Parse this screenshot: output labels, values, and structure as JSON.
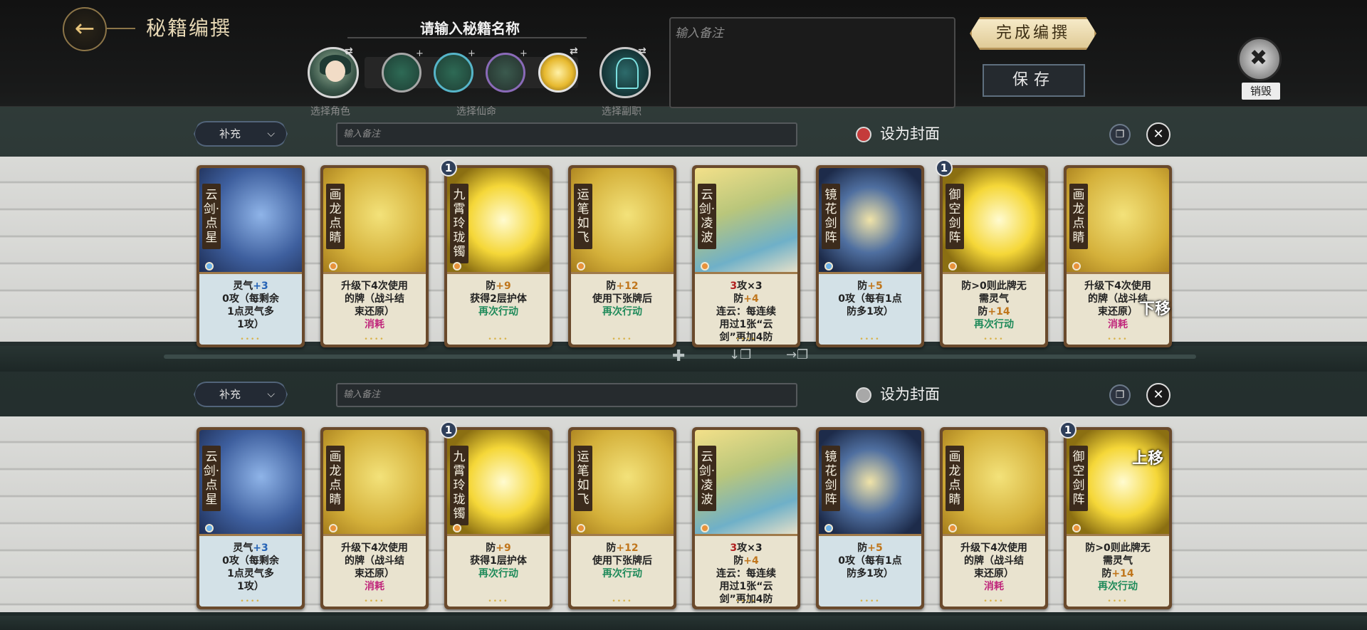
{
  "header": {
    "title": "秘籍编撰",
    "name_label": "请输入秘籍名称",
    "captions": {
      "character": "选择角色",
      "destiny": "选择仙命",
      "side_job": "选择副职"
    },
    "note_placeholder": "输入备注",
    "finish_label": "完成编撰",
    "save_label": "保存",
    "destroy_label": "销毁"
  },
  "rows": [
    {
      "supply_label": "补充",
      "note_placeholder": "输入备注",
      "cover_label": "设为封面",
      "cover_active": true,
      "move_hint": "下移",
      "cards": [
        {
          "name": "云剑·点星",
          "level": "",
          "desc": [
            "灵气+3",
            "0攻（每剩余",
            "1点灵气多",
            "1攻）"
          ]
        },
        {
          "name": "画龙点睛",
          "level": "",
          "desc": [
            "升级下4次使用",
            "的牌（战斗结",
            "束还原）",
            "消耗"
          ]
        },
        {
          "name": "九霄玲珑镯",
          "level": "1",
          "desc": [
            "防+9",
            "获得2层护体",
            "再次行动"
          ]
        },
        {
          "name": "运笔如飞",
          "level": "",
          "desc": [
            "防+12",
            "使用下张牌后",
            "再次行动"
          ]
        },
        {
          "name": "云剑·凌波",
          "level": "",
          "desc": [
            "3攻×3",
            "防+4",
            "连云：每连续",
            "用过1张“云",
            "剑”再加4防"
          ]
        },
        {
          "name": "镜花剑阵",
          "level": "",
          "desc": [
            "防+5",
            "0攻（每有1点",
            "防多1攻）"
          ]
        },
        {
          "name": "御空剑阵",
          "level": "1",
          "desc": [
            "防>0则此牌无",
            "需灵气",
            "防+14",
            "再次行动"
          ]
        },
        {
          "name": "画龙点睛",
          "level": "",
          "desc": [
            "升级下4次使用",
            "的牌（战斗结",
            "束还原）",
            "消耗"
          ]
        }
      ]
    },
    {
      "supply_label": "补充",
      "note_placeholder": "输入备注",
      "cover_label": "设为封面",
      "cover_active": false,
      "move_hint": "上移",
      "cards": [
        {
          "name": "云剑·点星",
          "level": "",
          "desc": [
            "灵气+3",
            "0攻（每剩余",
            "1点灵气多",
            "1攻）"
          ]
        },
        {
          "name": "画龙点睛",
          "level": "",
          "desc": [
            "升级下4次使用",
            "的牌（战斗结",
            "束还原）",
            "消耗"
          ]
        },
        {
          "name": "九霄玲珑镯",
          "level": "1",
          "desc": [
            "防+9",
            "获得1层护体",
            "再次行动"
          ]
        },
        {
          "name": "运笔如飞",
          "level": "",
          "desc": [
            "防+12",
            "使用下张牌后",
            "再次行动"
          ]
        },
        {
          "name": "云剑·凌波",
          "level": "",
          "desc": [
            "3攻×3",
            "防+4",
            "连云：每连续",
            "用过1张“云",
            "剑”再加4防"
          ]
        },
        {
          "name": "镜花剑阵",
          "level": "",
          "desc": [
            "防+5",
            "0攻（每有1点",
            "防多1攻）"
          ]
        },
        {
          "name": "画龙点睛",
          "level": "",
          "desc": [
            "升级下4次使用",
            "的牌（战斗结",
            "束还原）",
            "消耗"
          ]
        },
        {
          "name": "御空剑阵",
          "level": "1",
          "desc": [
            "防>0则此牌无",
            "需灵气",
            "防+14",
            "再次行动"
          ]
        }
      ]
    }
  ],
  "icons": {
    "back": "back-arrow-icon",
    "swap": "swap-icon",
    "add_card": "plus-icon",
    "copy": "copy-icon",
    "close": "close-icon",
    "destroy": "destroy-icon"
  }
}
